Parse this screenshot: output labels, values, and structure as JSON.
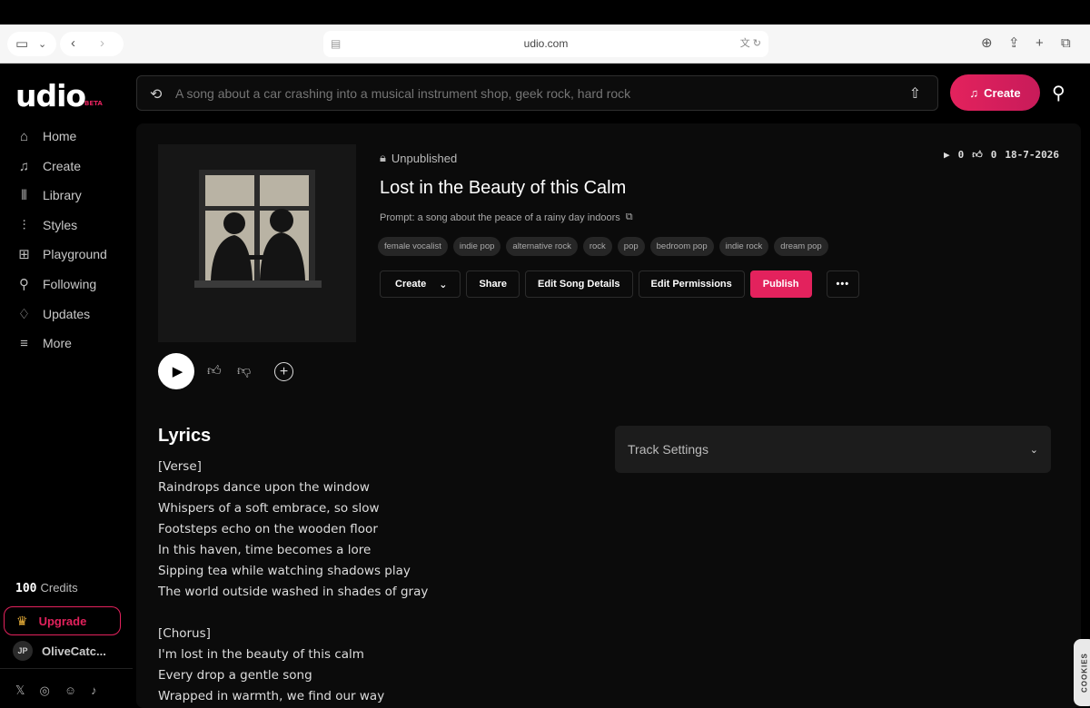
{
  "browser": {
    "url": "udio.com"
  },
  "logo": {
    "name": "udio",
    "badge": "BETA"
  },
  "sidebar": {
    "items": [
      {
        "label": "Home",
        "icon": "home-icon"
      },
      {
        "label": "Create",
        "icon": "music-note-icon"
      },
      {
        "label": "Library",
        "icon": "library-icon"
      },
      {
        "label": "Styles",
        "icon": "waveform-icon"
      },
      {
        "label": "Playground",
        "icon": "playground-icon"
      },
      {
        "label": "Following",
        "icon": "person-icon"
      },
      {
        "label": "Updates",
        "icon": "bell-icon"
      },
      {
        "label": "More",
        "icon": "menu-icon"
      }
    ],
    "credits_count": "100",
    "credits_label": "Credits",
    "upgrade_label": "Upgrade",
    "user_initials": "JP",
    "user_name": "OliveCatc..."
  },
  "search": {
    "placeholder": "A song about a car crashing into a musical instrument shop, geek rock, hard rock"
  },
  "header": {
    "create_label": "Create"
  },
  "song": {
    "status": "Unpublished",
    "plays": "0",
    "likes": "0",
    "date": "18-7-2026",
    "title": "Lost in the Beauty of this Calm",
    "prompt": "Prompt: a song about the peace of a rainy day indoors",
    "tags": [
      "female vocalist",
      "indie pop",
      "alternative rock",
      "rock",
      "pop",
      "bedroom pop",
      "indie rock",
      "dream pop"
    ],
    "actions": {
      "create": "Create",
      "share": "Share",
      "edit_details": "Edit Song Details",
      "edit_permissions": "Edit Permissions",
      "publish": "Publish"
    }
  },
  "lyrics": {
    "heading": "Lyrics",
    "text": "[Verse]\nRaindrops dance upon the window\nWhispers of a soft embrace, so slow\nFootsteps echo on the wooden floor\nIn this haven, time becomes a lore\nSipping tea while watching shadows play\nThe world outside washed in shades of gray\n\n[Chorus]\nI'm lost in the beauty of this calm\nEvery drop a gentle song\nWrapped in warmth, we find our way"
  },
  "track_settings": {
    "label": "Track Settings"
  },
  "cookie": {
    "label": "COOKIES"
  },
  "colors": {
    "accent": "#e3225d",
    "background": "#000000",
    "panel": "#0b0b0b"
  }
}
